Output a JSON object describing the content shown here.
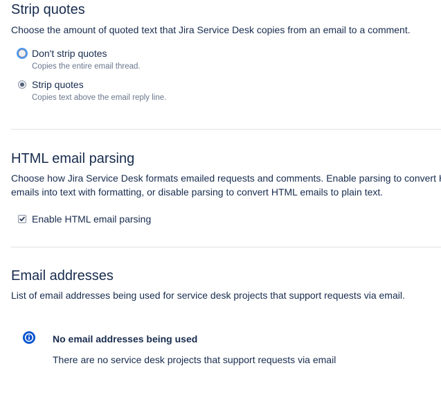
{
  "strip_quotes": {
    "heading": "Strip quotes",
    "description": "Choose the amount of quoted text that Jira Service Desk copies from an email to a comment.",
    "options": [
      {
        "label": "Don't strip quotes",
        "help": "Copies the entire email thread.",
        "selected": false
      },
      {
        "label": "Strip quotes",
        "help": "Copies text above the email reply line.",
        "selected": true
      }
    ]
  },
  "html_parsing": {
    "heading": "HTML email parsing",
    "description": "Choose how Jira Service Desk formats emailed requests and comments. Enable parsing to convert HTML emails into text with formatting, or disable parsing to convert HTML emails to plain text.",
    "checkbox_label": "Enable HTML email parsing",
    "checked": true
  },
  "email_addresses": {
    "heading": "Email addresses",
    "description": "List of email addresses being used for service desk projects that support requests via email.",
    "empty_state": {
      "icon": "info-icon",
      "title": "No email addresses being used",
      "body": "There are no service desk projects that support requests via email"
    }
  },
  "colors": {
    "text": "#172b4d",
    "subtle_text": "#6b778c",
    "divider": "#dfe1e6",
    "info_icon": "#0052cc",
    "focus_ring": "#4c9aff"
  }
}
